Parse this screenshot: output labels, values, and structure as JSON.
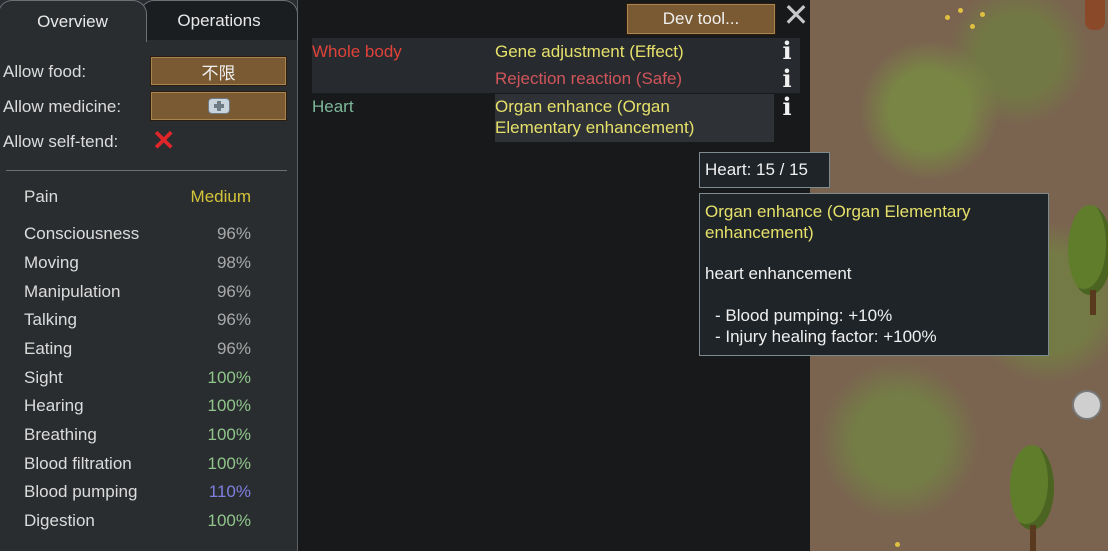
{
  "tabs": {
    "overview": "Overview",
    "operations": "Operations"
  },
  "settings": {
    "allow_food_label": "Allow food:",
    "allow_food_value": "不限",
    "allow_medicine_label": "Allow medicine:",
    "allow_self_tend_label": "Allow self-tend:",
    "self_tend_mark": "✕"
  },
  "capacities": [
    {
      "name": "Pain",
      "value": "Medium",
      "color": "#d4c43a"
    },
    {
      "name": "Consciousness",
      "value": "96%",
      "color": "#a8a8a8"
    },
    {
      "name": "Moving",
      "value": "98%",
      "color": "#a8a8a8"
    },
    {
      "name": "Manipulation",
      "value": "96%",
      "color": "#a8a8a8"
    },
    {
      "name": "Talking",
      "value": "96%",
      "color": "#a8a8a8"
    },
    {
      "name": "Eating",
      "value": "96%",
      "color": "#a8a8a8"
    },
    {
      "name": "Sight",
      "value": "100%",
      "color": "#8fc48a"
    },
    {
      "name": "Hearing",
      "value": "100%",
      "color": "#8fc48a"
    },
    {
      "name": "Breathing",
      "value": "100%",
      "color": "#8fc48a"
    },
    {
      "name": "Blood filtration",
      "value": "100%",
      "color": "#8fc48a"
    },
    {
      "name": "Blood pumping",
      "value": "110%",
      "color": "#7f7fe0"
    },
    {
      "name": "Digestion",
      "value": "100%",
      "color": "#8fc48a"
    }
  ],
  "toolbar": {
    "dev_tool": "Dev tool...",
    "close": "✕"
  },
  "health": {
    "whole_body": {
      "part": "Whole body",
      "part_color": "#e0423a",
      "hediffs": [
        {
          "label": "Gene adjustment (Effect)",
          "color": "#e6e06a"
        },
        {
          "label": "Rejection reaction (Safe)",
          "color": "#d0555a"
        }
      ]
    },
    "heart": {
      "part": "Heart",
      "part_color": "#7fb89a",
      "hediff_line1": "Organ enhance (Organ",
      "hediff_line2": "Elementary enhancement)",
      "hediff_color": "#e6e06a"
    },
    "info_icon": "i"
  },
  "tooltip_heart": {
    "text": "Heart:  15 / 15"
  },
  "tooltip_hediff": {
    "title_line1": "Organ enhance (Organ Elementary",
    "title_line2": "enhancement)",
    "description": "heart enhancement",
    "effect1": "- Blood pumping: +10%",
    "effect2": "- Injury healing factor: +100%",
    "title_color": "#e6e06a"
  }
}
